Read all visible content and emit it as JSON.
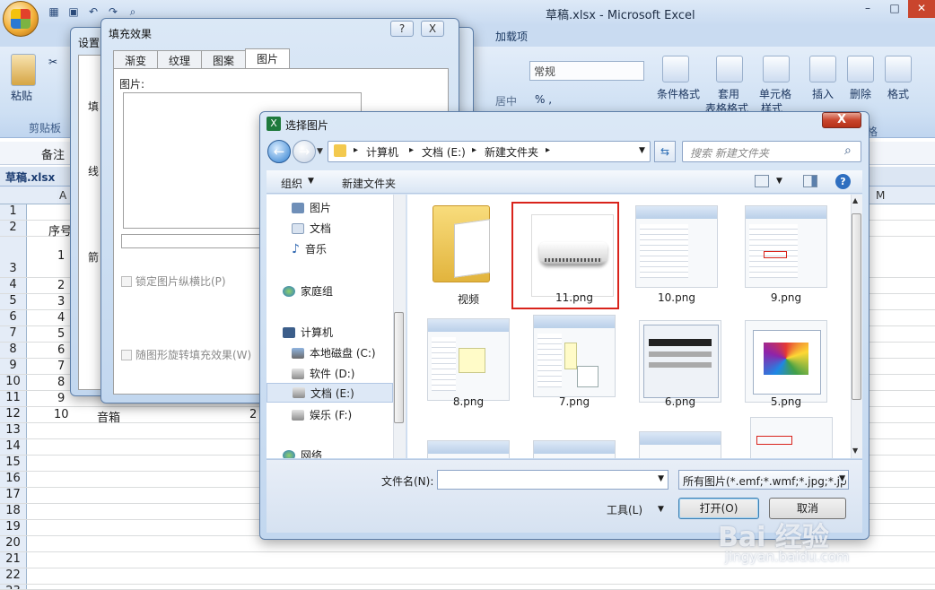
{
  "excel": {
    "title": "草稿.xlsx - Microsoft Excel",
    "addin_tab": "加载项",
    "ribbon": {
      "clipboard_label": "剪贴板",
      "paste_label": "粘贴",
      "number_format": "常规",
      "cond_format": "条件格式",
      "table_format": "套用",
      "table_format2": "表格格式",
      "cell_style": "单元格",
      "cell_style2": "样式",
      "insert": "插入",
      "delete": "删除",
      "format": "格式",
      "align_middle": "居中",
      "cells_label": "格"
    },
    "namebox": "备注",
    "workbook_tab": "草稿.xlsx",
    "col_a": "A",
    "col_m": "M",
    "rows": [
      {
        "n": "1",
        "a": "",
        "b": ""
      },
      {
        "n": "2",
        "a": "序号",
        "b": ""
      },
      {
        "n": "3",
        "a": "1",
        "b": ""
      },
      {
        "n": "4",
        "a": "2",
        "b": ""
      },
      {
        "n": "5",
        "a": "3",
        "b": ""
      },
      {
        "n": "6",
        "a": "4",
        "b": ""
      },
      {
        "n": "7",
        "a": "5",
        "b": ""
      },
      {
        "n": "8",
        "a": "6",
        "b": ""
      },
      {
        "n": "9",
        "a": "7",
        "b": ""
      },
      {
        "n": "10",
        "a": "8",
        "b": ""
      },
      {
        "n": "11",
        "a": "9",
        "b": ""
      },
      {
        "n": "12",
        "a": "10",
        "b": "音箱"
      },
      {
        "n": "13",
        "a": "",
        "b": ""
      },
      {
        "n": "14",
        "a": "",
        "b": ""
      },
      {
        "n": "15",
        "a": "",
        "b": ""
      },
      {
        "n": "16",
        "a": "",
        "b": ""
      },
      {
        "n": "17",
        "a": "",
        "b": ""
      },
      {
        "n": "18",
        "a": "",
        "b": ""
      },
      {
        "n": "19",
        "a": "",
        "b": ""
      },
      {
        "n": "20",
        "a": "",
        "b": ""
      },
      {
        "n": "21",
        "a": "",
        "b": ""
      },
      {
        "n": "22",
        "a": "",
        "b": ""
      },
      {
        "n": "23",
        "a": "",
        "b": ""
      }
    ],
    "row12_c": "2"
  },
  "format_dialog": {
    "title": "设置",
    "side_labels": [
      "填",
      "线",
      "箭"
    ]
  },
  "fill_dialog": {
    "title": "填充效果",
    "help": "?",
    "close": "X",
    "tabs": [
      "渐变",
      "纹理",
      "图案",
      "图片"
    ],
    "picture_label": "图片:",
    "lock_ratio": "锁定图片纵横比(P)",
    "rotate_fill": "随图形旋转填充效果(W)"
  },
  "pick_dialog": {
    "title": "选择图片",
    "close": "X",
    "path": [
      "计算机",
      "文档 (E:)",
      "新建文件夹"
    ],
    "search_placeholder": "搜索 新建文件夹",
    "organize": "组织",
    "new_folder": "新建文件夹",
    "help": "?",
    "nav": [
      {
        "label": "图片",
        "icon": "pictures-icon"
      },
      {
        "label": "文档",
        "icon": "documents-icon"
      },
      {
        "label": "音乐",
        "icon": "music-icon"
      },
      {
        "label": "家庭组",
        "icon": "homegroup-icon"
      },
      {
        "label": "计算机",
        "icon": "computer-icon"
      },
      {
        "label": "本地磁盘 (C:)",
        "icon": "drive-c-icon"
      },
      {
        "label": "软件 (D:)",
        "icon": "drive-icon"
      },
      {
        "label": "文档 (E:)",
        "icon": "drive-icon"
      },
      {
        "label": "娱乐 (F:)",
        "icon": "drive-icon"
      },
      {
        "label": "网络",
        "icon": "network-icon"
      }
    ],
    "files": [
      {
        "name": "视频",
        "kind": "folder"
      },
      {
        "name": "11.png",
        "kind": "aircon"
      },
      {
        "name": "10.png",
        "kind": "sheet"
      },
      {
        "name": "9.png",
        "kind": "sheet"
      },
      {
        "name": "8.png",
        "kind": "sheet"
      },
      {
        "name": "7.png",
        "kind": "sheet"
      },
      {
        "name": "6.png",
        "kind": "dialog"
      },
      {
        "name": "5.png",
        "kind": "dialog"
      }
    ],
    "filename_label": "文件名(N):",
    "filename_value": "",
    "filetype": "所有图片(*.emf;*.wmf;*.jpg;*.jp",
    "tools": "工具(L)",
    "open": "打开(O)",
    "cancel": "取消"
  },
  "watermark": {
    "main": "Bai 经验",
    "sub": "jingyan.baidu.com"
  },
  "colors": {
    "selection": "#d9231b",
    "accent": "#1c3d72"
  }
}
